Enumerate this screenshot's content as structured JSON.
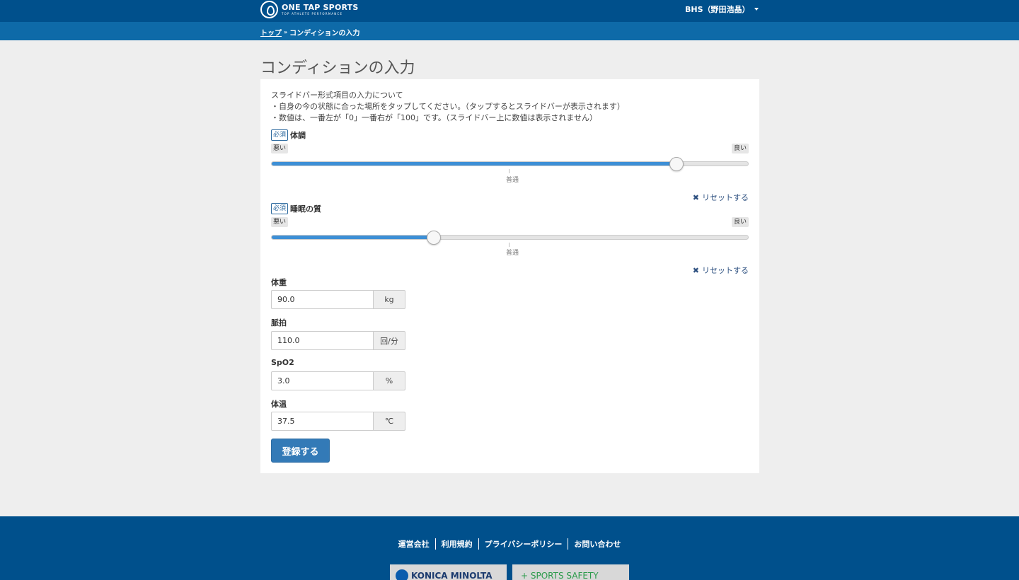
{
  "header": {
    "logo_main": "ONE TAP SPORTS",
    "logo_sub": "TOP ATHLETE PERFORMANCE",
    "user_label": "BHS（野田浩晶）"
  },
  "breadcrumb": {
    "home": "トップ",
    "separator": "»",
    "current": "コンディションの入力"
  },
  "page": {
    "title": "コンディションの入力",
    "intro": [
      "スライドバー形式項目の入力について",
      "・自身の今の状態に合った場所をタップしてください。（タップするとスライドバーが表示されます）",
      "・数値は、一番左が「0」一番右が「100」です。（スライドバー上に数値は表示されません）"
    ]
  },
  "sliders": [
    {
      "required": "必須",
      "label": "体調",
      "low_label": "悪い",
      "high_label": "良い",
      "mid_label": "普通",
      "value": 85,
      "reset_label": "リセットする"
    },
    {
      "required": "必須",
      "label": "睡眠の質",
      "low_label": "悪い",
      "high_label": "良い",
      "mid_label": "普通",
      "value": 34,
      "reset_label": "リセットする"
    }
  ],
  "fields": [
    {
      "label": "体重",
      "value": "90.0",
      "unit": "kg"
    },
    {
      "label": "脈拍",
      "value": "110.0",
      "unit": "回/分"
    },
    {
      "label": "SpO2",
      "value": "3.0",
      "unit": "%"
    },
    {
      "label": "体温",
      "value": "37.5",
      "unit": "℃"
    }
  ],
  "submit_label": "登録する",
  "footer": {
    "links": [
      "運営会社",
      "利用規約",
      "プライバシーポリシー",
      "お問い合わせ"
    ],
    "sponsors": [
      "KONICA MINOLTA",
      "+ SPORTS SAFETY"
    ]
  },
  "colors": {
    "header": "#00508c",
    "breadcrumb_bar": "#0e6aa8",
    "accent": "#337ab7",
    "slider_fill": "#3d8fd6"
  }
}
